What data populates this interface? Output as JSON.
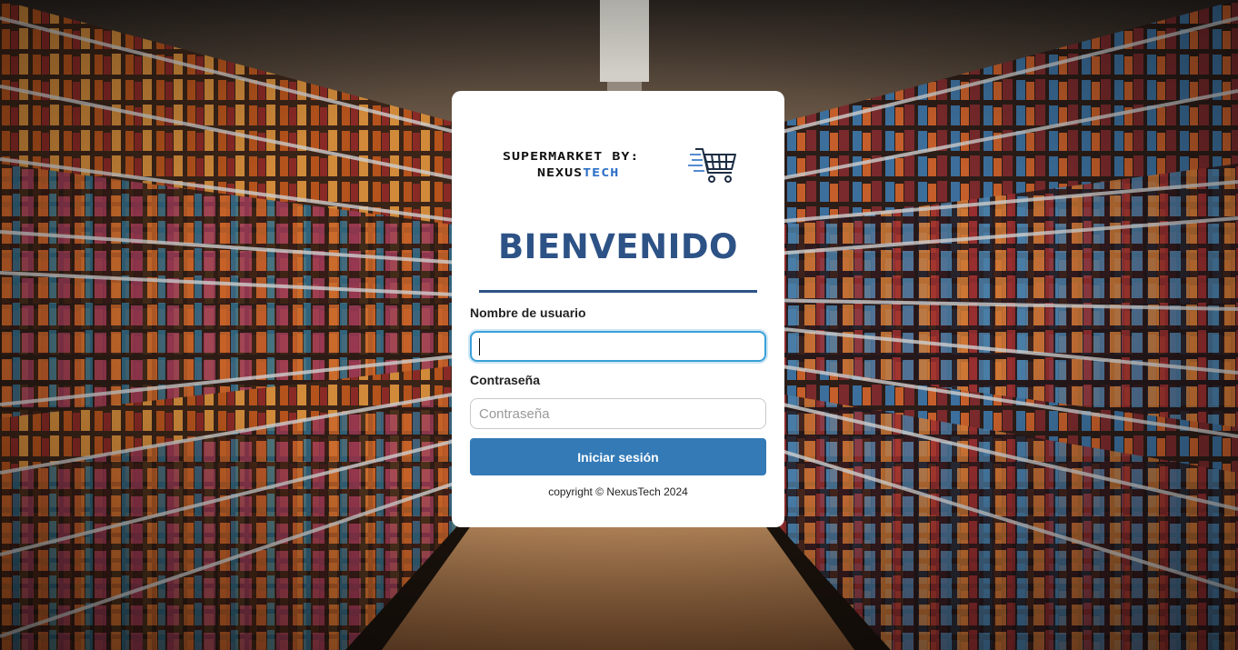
{
  "brand": {
    "line1": "SUPERMARKET BY:",
    "line2_a": "NEXUS",
    "line2_b": "TECH",
    "accent": "#2a6ec6",
    "icon": "shopping-cart-icon"
  },
  "login": {
    "title": "BIENVENIDO",
    "username_label": "Nombre de usuario",
    "username_value": "",
    "password_label": "Contraseña",
    "password_placeholder": "Contraseña",
    "submit_label": "Iniciar sesión",
    "copyright": "copyright © NexusTech 2024"
  },
  "colors": {
    "title": "#2d5286",
    "button": "#337ab7",
    "focus_border": "#3aa0d8"
  },
  "background": {
    "scene": "supermarket aisle"
  }
}
